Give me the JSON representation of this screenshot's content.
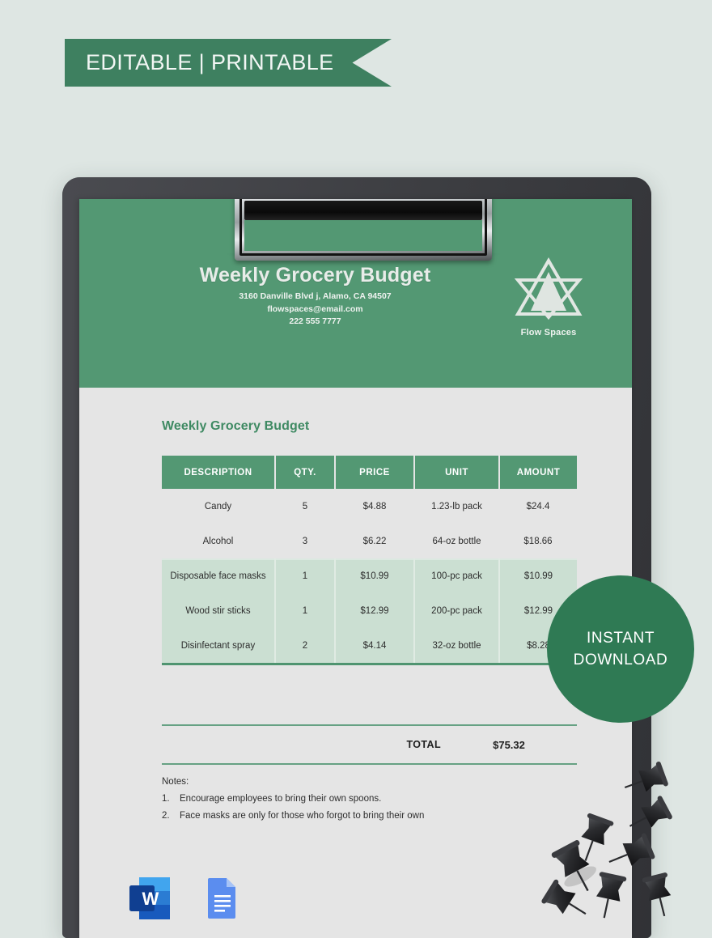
{
  "ribbon": {
    "label": "EDITABLE | PRINTABLE"
  },
  "badge": {
    "line1": "INSTANT",
    "line2": "DOWNLOAD"
  },
  "letterhead": {
    "title": "Weekly Grocery Budget",
    "address": "3160 Danville Blvd j, Alamo, CA 94507",
    "email": "flowspaces@email.com",
    "phone": "222 555 7777",
    "logo_name": "Flow Spaces",
    "logo_icon": "six-pointed-star-icon"
  },
  "document": {
    "section_title": "Weekly Grocery Budget",
    "table": {
      "columns": [
        "DESCRIPTION",
        "QTY.",
        "PRICE",
        "UNIT",
        "AMOUNT"
      ],
      "rows": [
        {
          "style": "plain",
          "description": "Candy",
          "qty": "5",
          "price": "$4.88",
          "unit": "1.23-lb pack",
          "amount": "$24.4"
        },
        {
          "style": "plain",
          "description": "Alcohol",
          "qty": "3",
          "price": "$6.22",
          "unit": "64-oz bottle",
          "amount": "$18.66"
        },
        {
          "style": "tint",
          "description": "Disposable face masks",
          "qty": "1",
          "price": "$10.99",
          "unit": "100-pc pack",
          "amount": "$10.99"
        },
        {
          "style": "tint",
          "description": "Wood stir sticks",
          "qty": "1",
          "price": "$12.99",
          "unit": "200-pc pack",
          "amount": "$12.99"
        },
        {
          "style": "tint",
          "description": "Disinfectant spray",
          "qty": "2",
          "price": "$4.14",
          "unit": "32-oz bottle",
          "amount": "$8.28"
        }
      ]
    },
    "total": {
      "label": "TOTAL",
      "value": "$75.32"
    },
    "notes": {
      "label": "Notes:",
      "items": [
        {
          "num": "1.",
          "text": "Encourage employees to bring their own spoons."
        },
        {
          "num": "2.",
          "text": "Face masks are only for those who forgot to bring their own"
        }
      ]
    }
  },
  "file_formats": [
    {
      "name": "microsoft-word-icon",
      "label": "W"
    },
    {
      "name": "google-docs-icon",
      "label": ""
    }
  ],
  "colors": {
    "page_background": "#dee6e3",
    "brand_green": "#539873",
    "ribbon_green": "#3e8060",
    "badge_green": "#2f7a54",
    "table_row_tint": "#cbdfd2",
    "document_body": "#e5e5e5",
    "clipboard_dark": "#414246",
    "title_green": "#3f8a63"
  }
}
